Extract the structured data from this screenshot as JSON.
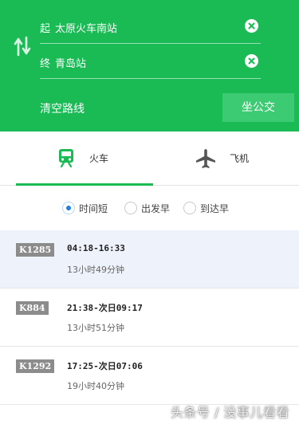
{
  "route": {
    "start_prefix": "起",
    "start_station": "太原火车南站",
    "end_prefix": "终",
    "end_station": "青岛站",
    "clear_label": "清空路线",
    "bus_button_label": "坐公交"
  },
  "tabs": [
    {
      "label": "火车",
      "icon": "train-icon",
      "active": true
    },
    {
      "label": "飞机",
      "icon": "plane-icon",
      "active": false
    }
  ],
  "sort_options": [
    {
      "label": "时间短",
      "selected": true
    },
    {
      "label": "出发早",
      "selected": false
    },
    {
      "label": "到达早",
      "selected": false
    }
  ],
  "trains": [
    {
      "code": "K1285",
      "time": "04:18-16:33",
      "duration": "13小时49分钟"
    },
    {
      "code": "K884",
      "time": "21:38-次日09:17",
      "duration": "13小时51分钟"
    },
    {
      "code": "K1292",
      "time": "17:25-次日07:06",
      "duration": "19小时40分钟"
    }
  ],
  "watermark": "头条号 / 没事儿看看",
  "colors": {
    "brand_green": "#1aba55",
    "radio_blue": "#1f7fe5",
    "train_code_bg": "#8c8c8c",
    "selected_row_bg": "#eef2fa"
  }
}
